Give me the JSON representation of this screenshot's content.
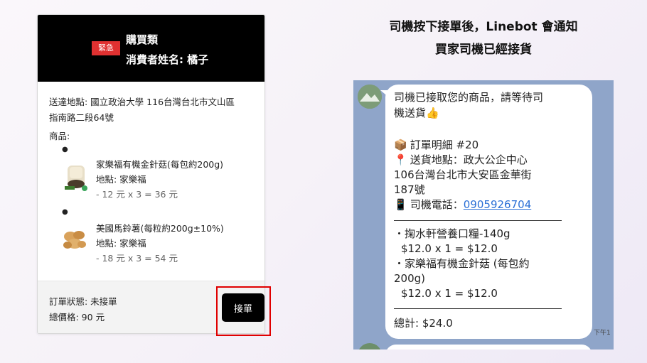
{
  "order_card": {
    "urgent_badge": "緊急",
    "category": "購買類",
    "consumer_name": "消費者姓名: 橘子",
    "address_line1": "送達地點: 國立政治大學 116台灣台北市文山區",
    "address_line2": "指南路二段64號",
    "products_label": "商品:",
    "products": [
      {
        "name": "家樂福有機金針菇(每包約200g)",
        "store": "地點: 家樂福",
        "calc": "- 12 元 x 3 = 36 元",
        "icon": "mushroom-icon"
      },
      {
        "name": "美國馬鈴薯(每粒約200g±10%)",
        "store": "地點: 家樂福",
        "calc": "- 18 元 x 3 = 54 元",
        "icon": "potato-icon"
      }
    ],
    "status": "訂單狀態: 未接單",
    "total": "總價格: 90 元",
    "accept_button": "接單"
  },
  "caption": {
    "line1": "司機按下接單後，Linebot 會通知",
    "line2": "買家司機已經接貨"
  },
  "chat": {
    "lines": [
      "司機已接取您的商品，請等待司",
      "機送貨",
      "訂單明細 #20",
      "送貨地點：政大公企中心",
      "106台灣台北市大安區金華街",
      "187號",
      "司機電話：",
      "0905926704",
      "・掬水軒營養口糧-140g",
      "$12.0 x 1 = $12.0",
      "・家樂福有機金針菇 (每包約",
      "200g)",
      "$12.0 x 1 = $12.0",
      "總計: $24.0"
    ],
    "time": "下午1",
    "emojis": {
      "thumb": "👍",
      "package": "📦",
      "pin": "📍",
      "phone": "📱"
    }
  },
  "colors": {
    "header_bg": "#000000",
    "urgent": "#e03131",
    "highlight": "#e00000",
    "chat_bg": "#8fa5c9",
    "link": "#2a6fd6"
  }
}
